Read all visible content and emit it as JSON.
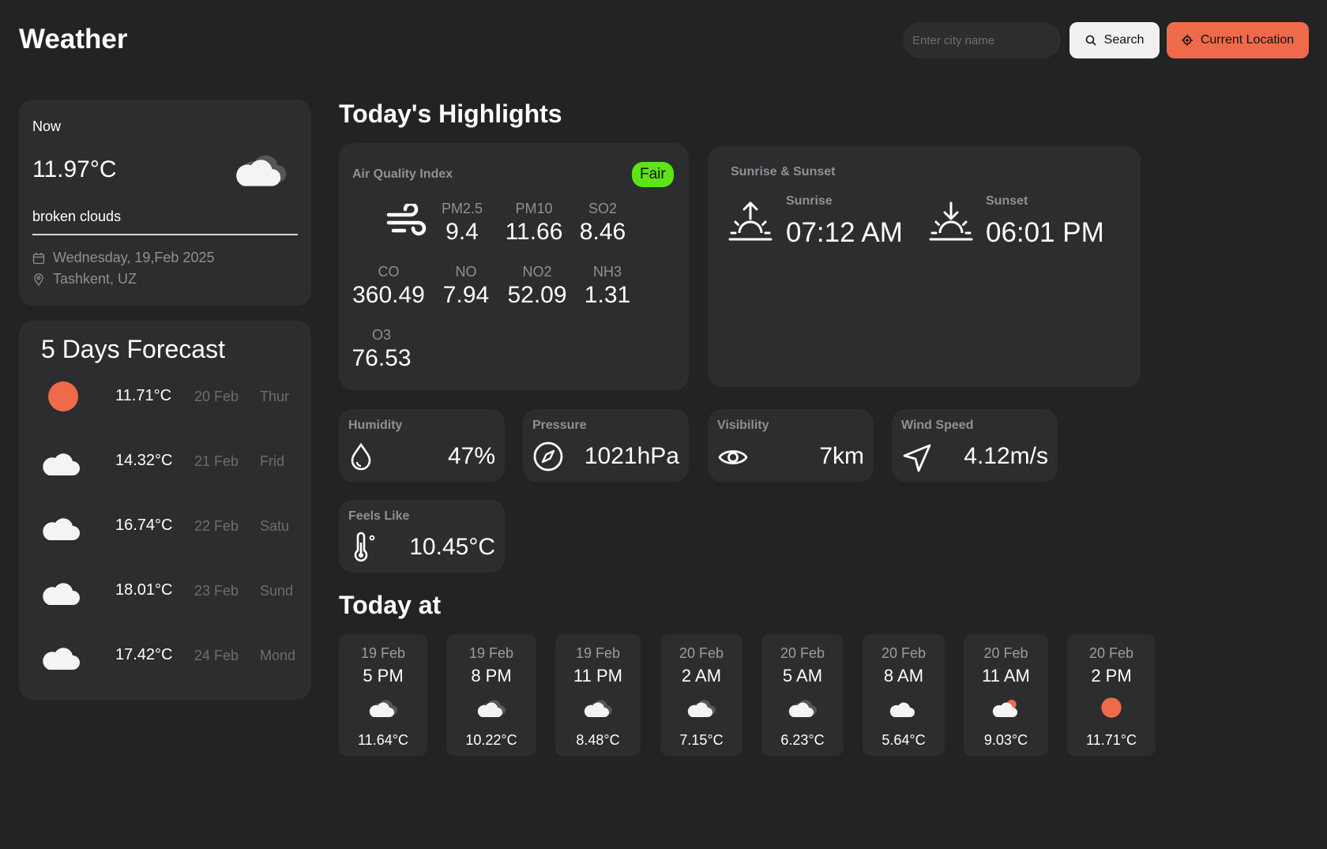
{
  "header": {
    "title": "Weather",
    "search_placeholder": "Enter city name",
    "search_label": "Search",
    "location_label": "Current Location"
  },
  "now": {
    "label": "Now",
    "temp": "11.97°C",
    "description": "broken clouds",
    "date": "Wednesday, 19,Feb 2025",
    "location": "Tashkent, UZ",
    "icon": "broken-clouds-icon"
  },
  "forecast": {
    "title": "5 Days Forecast",
    "items": [
      {
        "icon": "sun-icon",
        "temp": "11.71°C",
        "date": "20 Feb",
        "day": "Thur"
      },
      {
        "icon": "cloud-icon",
        "temp": "14.32°C",
        "date": "21 Feb",
        "day": "Frid"
      },
      {
        "icon": "cloud-icon",
        "temp": "16.74°C",
        "date": "22 Feb",
        "day": "Satu"
      },
      {
        "icon": "cloud-icon",
        "temp": "18.01°C",
        "date": "23 Feb",
        "day": "Sund"
      },
      {
        "icon": "cloud-icon",
        "temp": "17.42°C",
        "date": "24 Feb",
        "day": "Mond"
      }
    ]
  },
  "highlights": {
    "title": "Today's Highlights",
    "aqi": {
      "label": "Air Quality Index",
      "status": "Fair",
      "status_color": "#5ee317",
      "pm25_label": "PM2.5",
      "pm25": "9.4",
      "pm10_label": "PM10",
      "pm10": "11.66",
      "so2_label": "SO2",
      "so2": "8.46",
      "co_label": "CO",
      "co": "360.49",
      "no_label": "NO",
      "no": "7.94",
      "no2_label": "NO2",
      "no2": "52.09",
      "nh3_label": "NH3",
      "nh3": "1.31",
      "o3_label": "O3",
      "o3": "76.53"
    },
    "sun": {
      "label": "Sunrise & Sunset",
      "sunrise_label": "Sunrise",
      "sunrise": "07:12 AM",
      "sunset_label": "Sunset",
      "sunset": "06:01 PM"
    },
    "humidity": {
      "label": "Humidity",
      "value": "47%"
    },
    "pressure": {
      "label": "Pressure",
      "value": "1021hPa"
    },
    "visibility": {
      "label": "Visibility",
      "value": "7km"
    },
    "wind": {
      "label": "Wind Speed",
      "value": "4.12m/s"
    },
    "feels": {
      "label": "Feels Like",
      "value": "10.45°C"
    }
  },
  "today": {
    "title": "Today at",
    "hours": [
      {
        "date": "19 Feb",
        "time": "5 PM",
        "icon": "broken-clouds-icon",
        "temp": "11.64°C"
      },
      {
        "date": "19 Feb",
        "time": "8 PM",
        "icon": "broken-clouds-icon",
        "temp": "10.22°C"
      },
      {
        "date": "19 Feb",
        "time": "11 PM",
        "icon": "broken-clouds-icon",
        "temp": "8.48°C"
      },
      {
        "date": "20 Feb",
        "time": "2 AM",
        "icon": "broken-clouds-icon",
        "temp": "7.15°C"
      },
      {
        "date": "20 Feb",
        "time": "5 AM",
        "icon": "broken-clouds-icon",
        "temp": "6.23°C"
      },
      {
        "date": "20 Feb",
        "time": "8 AM",
        "icon": "cloud-icon",
        "temp": "5.64°C"
      },
      {
        "date": "20 Feb",
        "time": "11 AM",
        "icon": "few-clouds-icon",
        "temp": "9.03°C"
      },
      {
        "date": "20 Feb",
        "time": "2 PM",
        "icon": "sun-icon",
        "temp": "11.71°C"
      }
    ]
  },
  "colors": {
    "background": "#212325",
    "card": "#2b2d2f",
    "accent": "#ef6a4b",
    "muted": "#8e9093"
  }
}
